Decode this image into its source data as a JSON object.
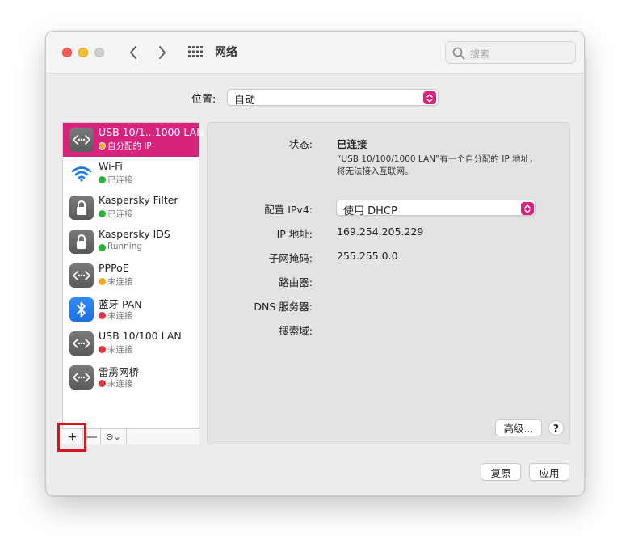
{
  "window": {
    "title": "网络"
  },
  "search": {
    "placeholder": "搜索"
  },
  "location": {
    "label": "位置:",
    "value": "自动"
  },
  "services": [
    {
      "name": "USB 10/1...1000 LAN",
      "status": "自分配的 IP",
      "status_color": "yellow",
      "icon": "ethernet-icon",
      "selected": true
    },
    {
      "name": "Wi-Fi",
      "status": "已连接",
      "status_color": "green",
      "icon": "wifi-icon"
    },
    {
      "name": "Kaspersky Filter",
      "status": "已连接",
      "status_color": "green",
      "icon": "lock-icon"
    },
    {
      "name": "Kaspersky IDS",
      "status": "Running",
      "status_color": "green",
      "icon": "lock-icon"
    },
    {
      "name": "PPPoE",
      "status": "未连接",
      "status_color": "yellow",
      "icon": "ethernet-icon"
    },
    {
      "name": "蓝牙 PAN",
      "status": "未连接",
      "status_color": "red",
      "icon": "bluetooth-icon"
    },
    {
      "name": "USB 10/100 LAN",
      "status": "未连接",
      "status_color": "red",
      "icon": "ethernet-icon"
    },
    {
      "name": "雷雳网桥",
      "status": "未连接",
      "status_color": "red",
      "icon": "ethernet-icon"
    }
  ],
  "toolbar": {
    "add": "+",
    "remove": "—",
    "action": "⊝⌄"
  },
  "detail": {
    "status_label": "状态:",
    "status_value": "已连接",
    "status_desc": "“USB 10/100/1000 LAN”有一个自分配的 IP 地址，将无法接入互联网。",
    "ipv4_label": "配置 IPv4:",
    "ipv4_value": "使用 DHCP",
    "ip_label": "IP 地址:",
    "ip_value": "169.254.205.229",
    "mask_label": "子网掩码:",
    "mask_value": "255.255.0.0",
    "router_label": "路由器:",
    "dns_label": "DNS 服务器:",
    "search_domain_label": "搜索域:",
    "advanced": "高级...",
    "help": "?"
  },
  "buttons": {
    "revert": "复原",
    "apply": "应用"
  },
  "colors": {
    "accent": "#d6247d",
    "highlight": "#d9141d"
  }
}
